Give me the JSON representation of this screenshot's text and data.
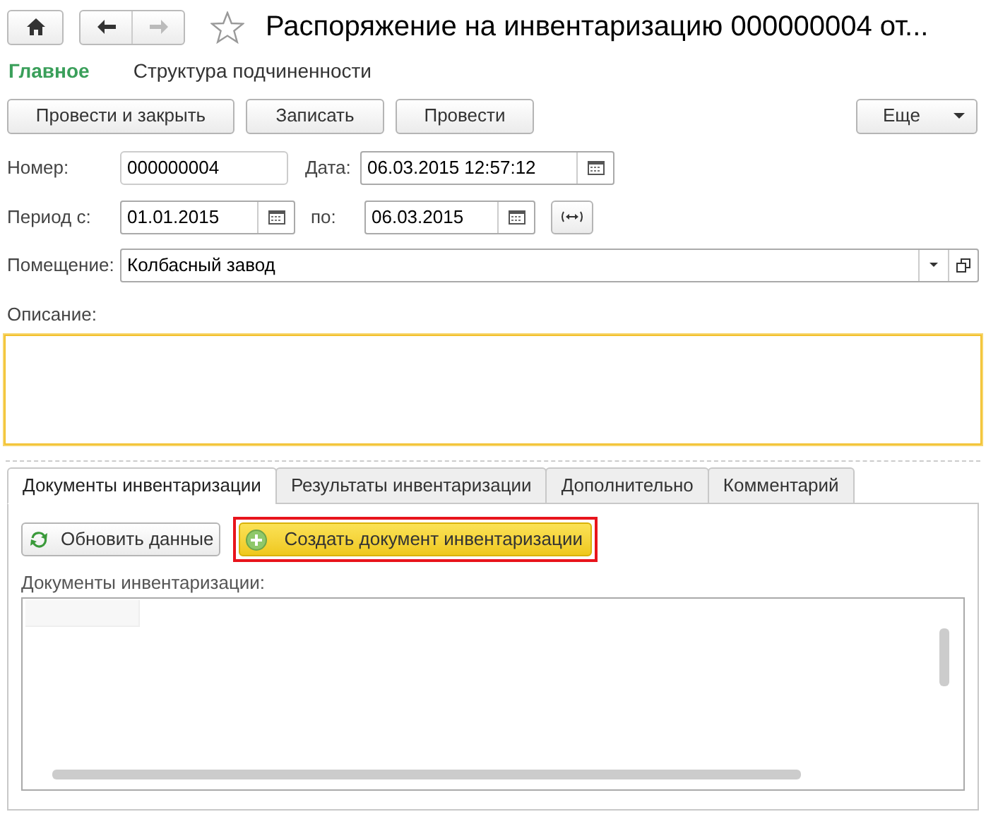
{
  "window": {
    "title": "Распоряжение на инвентаризацию 000000004 от...",
    "favorite": false
  },
  "sections": [
    {
      "label": "Главное",
      "selected": true
    },
    {
      "label": "Структура подчиненности",
      "selected": false
    }
  ],
  "command_bar": {
    "buttons": [
      "Провести и закрыть",
      "Записать",
      "Провести"
    ],
    "more": "Еще"
  },
  "form": {
    "number_label": "Номер:",
    "number": "000000004",
    "date_label": "Дата:",
    "date": "06.03.2015 12:57:12",
    "period_label": "Период с:",
    "period_from": "01.01.2015",
    "period_to_label": "по:",
    "period_to": "06.03.2015",
    "room_label": "Помещение:",
    "room": "Колбасный завод",
    "description_label": "Описание:",
    "description_focused": true
  },
  "tabs": [
    {
      "label": "Документы инвентаризации",
      "selected": true
    },
    {
      "label": "Результаты инвентаризации",
      "selected": false
    },
    {
      "label": "Дополнительно",
      "selected": false
    },
    {
      "label": "Комментарий",
      "selected": false
    }
  ],
  "panel": {
    "refresh_button": "Обновить данные",
    "create_button": {
      "label": "Создать документ инвентаризации",
      "highlighted": true
    },
    "list_label": "Документы инвентаризации:"
  }
}
